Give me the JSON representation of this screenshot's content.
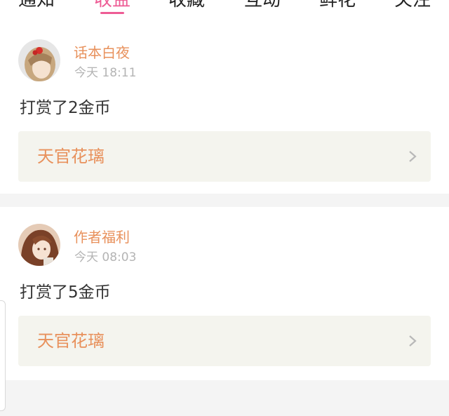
{
  "tabs": [
    {
      "label": "通知",
      "active": false
    },
    {
      "label": "收益",
      "active": true
    },
    {
      "label": "收藏",
      "active": false
    },
    {
      "label": "互动",
      "active": false
    },
    {
      "label": "鲜花",
      "active": false
    },
    {
      "label": "关注",
      "active": false
    }
  ],
  "notifications": [
    {
      "username": "话本白夜",
      "time": "今天 18:11",
      "message": "打赏了2金币",
      "book_title": "天官花璃"
    },
    {
      "username": "作者福利",
      "time": "今天 08:03",
      "message": "打赏了5金币",
      "book_title": "天官花璃"
    }
  ],
  "colors": {
    "accent": "#ee5c95",
    "username": "#e8915c",
    "book_title": "#e8915c",
    "card_background": "#f4f4ee"
  },
  "icons": {
    "chevron": "chevron-right-icon"
  }
}
